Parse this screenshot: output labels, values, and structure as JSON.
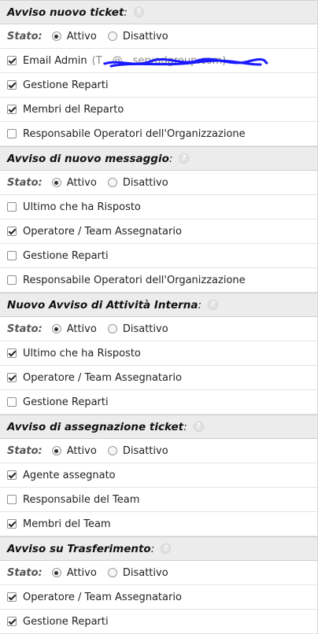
{
  "stato_label": "Stato:",
  "radio_on_label": "Attivo",
  "radio_off_label": "Disattivo",
  "sections": [
    {
      "title": "Avviso nuovo ticket",
      "active": true,
      "options": [
        {
          "label": "Email Admin",
          "checked": true,
          "extra": "(T…@…servadgroup.com)"
        },
        {
          "label": "Gestione Reparti",
          "checked": true
        },
        {
          "label": "Membri del Reparto",
          "checked": true
        },
        {
          "label": "Responsabile Operatori dell'Organizzazione",
          "checked": false
        }
      ]
    },
    {
      "title": "Avviso di nuovo messaggio",
      "active": true,
      "options": [
        {
          "label": "Ultimo che ha Risposto",
          "checked": false
        },
        {
          "label": "Operatore / Team Assegnatario",
          "checked": true
        },
        {
          "label": "Gestione Reparti",
          "checked": false
        },
        {
          "label": "Responsabile Operatori dell'Organizzazione",
          "checked": false
        }
      ]
    },
    {
      "title": "Nuovo Avviso di Attività Interna",
      "active": true,
      "options": [
        {
          "label": "Ultimo che ha Risposto",
          "checked": true
        },
        {
          "label": "Operatore / Team Assegnatario",
          "checked": true
        },
        {
          "label": "Gestione Reparti",
          "checked": false
        }
      ]
    },
    {
      "title": "Avviso di assegnazione ticket",
      "active": true,
      "options": [
        {
          "label": "Agente assegnato",
          "checked": true
        },
        {
          "label": "Responsabile del Team",
          "checked": false
        },
        {
          "label": "Membri del Team",
          "checked": true
        }
      ]
    },
    {
      "title": "Avviso su Trasferimento",
      "active": true,
      "options": [
        {
          "label": "Operatore / Team Assegnatario",
          "checked": true
        },
        {
          "label": "Gestione Reparti",
          "checked": true
        }
      ]
    }
  ],
  "colors": {
    "header_bg": "#ececec",
    "scribble": "#1a1aff"
  },
  "icons": {
    "help": "help-circle-icon"
  }
}
